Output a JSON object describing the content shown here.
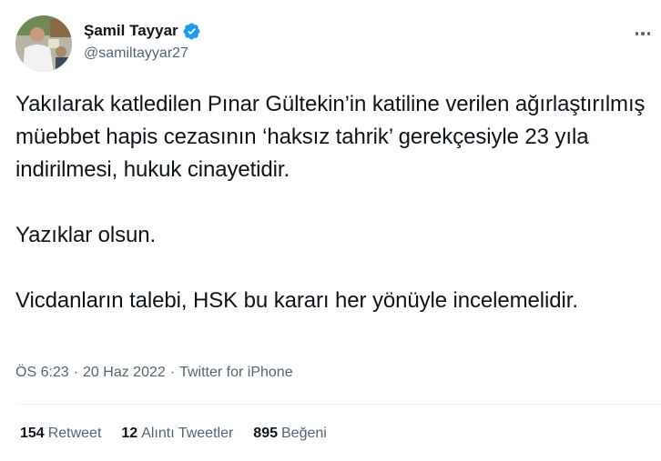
{
  "author": {
    "display_name": "Şamil Tayyar",
    "handle": "@samiltayyar27",
    "verified_icon": "verified-badge-icon",
    "accent_color": "#1d9bf0"
  },
  "tweet": {
    "paragraphs": [
      "Yakılarak katledilen Pınar Gültekin’in katiline verilen ağırlaştırılmış müebbet hapis cezasının ‘haksız tahrik’ gerekçesiyle 23 yıla indirilmesi, hukuk cinayetidir.",
      "Yazıklar olsun.",
      "Vicdanların talebi, HSK bu kararı her yönüyle incelemelidir."
    ]
  },
  "meta": {
    "time": "ÖS 6:23",
    "separator": "·",
    "date": "20 Haz 2022",
    "source": "Twitter for iPhone"
  },
  "stats": {
    "retweets": {
      "count": "154",
      "label": "Retweet"
    },
    "quotes": {
      "count": "12",
      "label": "Alıntı Tweetler"
    },
    "likes": {
      "count": "895",
      "label": "Beğeni"
    }
  }
}
